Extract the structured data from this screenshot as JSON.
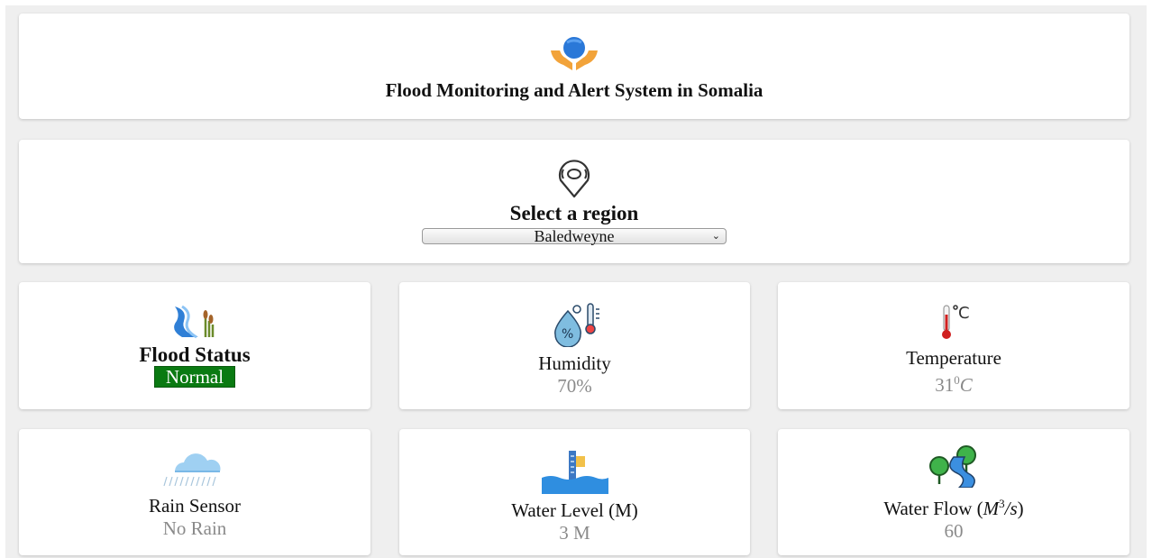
{
  "header": {
    "title": "Flood Monitoring and Alert System in Somalia",
    "icon": "hands-globe-icon"
  },
  "region": {
    "label": "Select a region",
    "selected": "Baledweyne",
    "icon": "location-pin-icon"
  },
  "cards": {
    "flood_status": {
      "title": "Flood Status",
      "value": "Normal",
      "icon": "river-icon",
      "badge_color": "#0a7a12"
    },
    "humidity": {
      "title": "Humidity",
      "value": "70%",
      "icon": "humidity-icon"
    },
    "temperature": {
      "title": "Temperature",
      "value": "31",
      "superscript": "0",
      "unit": "C",
      "icon": "thermometer-icon"
    },
    "rain_sensor": {
      "title": "Rain Sensor",
      "value": "No Rain",
      "icon": "rain-cloud-icon"
    },
    "water_level": {
      "title": "Water Level (M)",
      "value": "3 M",
      "icon": "water-level-icon"
    },
    "water_flow": {
      "title_prefix": "Water Flow (",
      "unit_base": "M",
      "unit_exp": "3",
      "unit_rest": "/s",
      "title_suffix": ")",
      "value": "60",
      "icon": "water-flow-icon"
    }
  }
}
